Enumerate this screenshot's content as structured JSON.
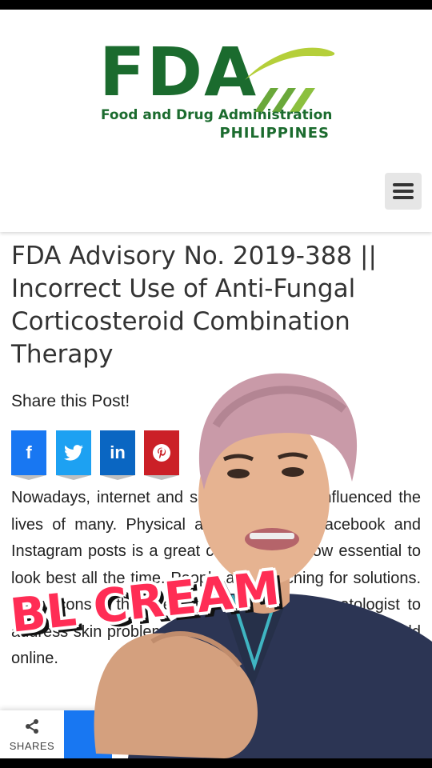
{
  "header": {
    "logo_main": "FDA",
    "logo_line1": "Food and Drug Administration",
    "logo_line2": "PHILIPPINES",
    "menu_icon": "hamburger-icon"
  },
  "article": {
    "title": "FDA Advisory No. 2019-388 || Incorrect Use of Anti-Fungal Corticosteroid Combination Therapy",
    "share_label": "Share this Post!",
    "share_buttons": [
      {
        "network": "facebook",
        "glyph": "f",
        "color": "#1877f2"
      },
      {
        "network": "twitter",
        "glyph": "🐦",
        "color": "#1da1f2"
      },
      {
        "network": "linkedin",
        "glyph": "in",
        "color": "#0a66c2"
      },
      {
        "network": "pinterest",
        "glyph": "P",
        "color": "#cb2027"
      }
    ],
    "body_text": "Nowadays, internet and social media has influenced the lives of many. Physical appearance on Facebook and Instagram posts is a great concern, it is now essential to look best all the time. People are searching for solutions. Many consult the internet instead of a dermatologist to address skin problems using beauty products widely sold online."
  },
  "bottom_bar": {
    "shares_label": "SHARES",
    "share_icon": "share-icon"
  },
  "overlay": {
    "caption": "BL CREAM"
  }
}
